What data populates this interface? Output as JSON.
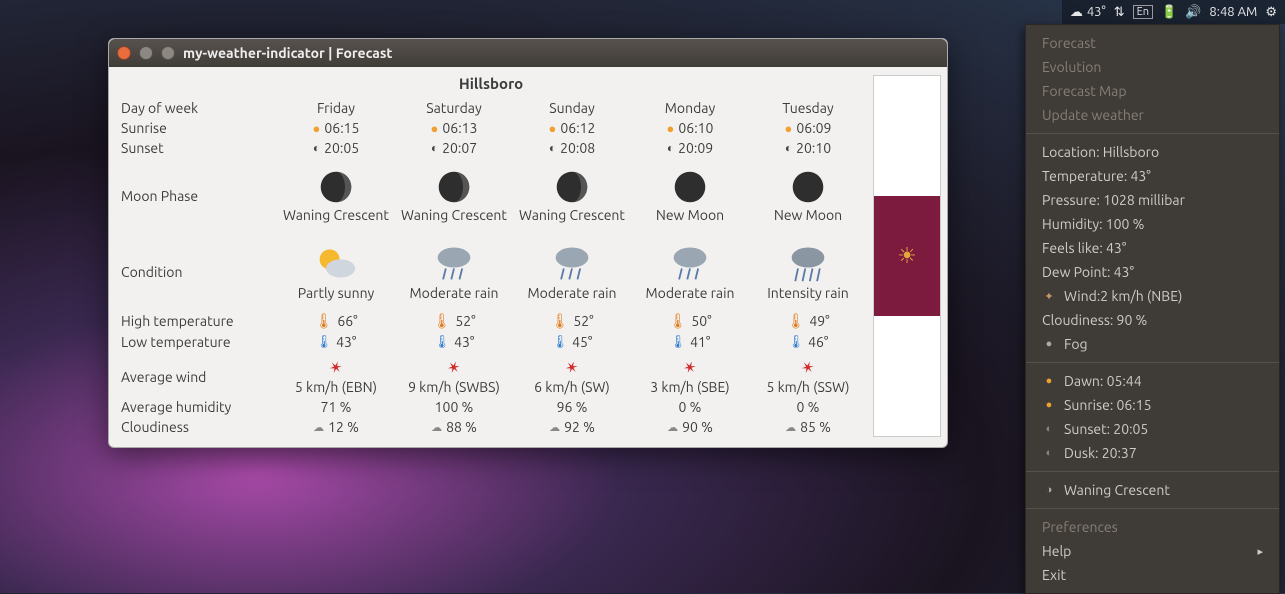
{
  "panel": {
    "weather_temp": "43°",
    "input_method": "En",
    "time": "8:48 AM"
  },
  "dropdown": {
    "top_items": [
      "Forecast",
      "Evolution",
      "Forecast Map",
      "Update weather"
    ],
    "location_label": "Location: Hillsboro",
    "temperature": "Temperature: 43°",
    "pressure": "Pressure: 1028 millibar",
    "humidity": "Humidity: 100 %",
    "feels_like": "Feels like: 43°",
    "dew_point": "Dew Point: 43°",
    "wind": "Wind:2 km/h (NBE)",
    "cloudiness": "Cloudiness: 90 %",
    "condition": "Fog",
    "dawn": "Dawn: 05:44",
    "sunrise": "Sunrise: 06:15",
    "sunset": "Sunset: 20:05",
    "dusk": "Dusk: 20:37",
    "moon_phase": "Waning Crescent",
    "preferences": "Preferences",
    "help": "Help",
    "exit": "Exit"
  },
  "window": {
    "title": "my-weather-indicator | Forecast",
    "city": "Hillsboro",
    "row_labels": {
      "day": "Day of week",
      "sunrise": "Sunrise",
      "sunset": "Sunset",
      "moon": "Moon Phase",
      "condition": "Condition",
      "high": "High temperature",
      "low": "Low temperature",
      "wind": "Average wind",
      "humidity": "Average humidity",
      "cloud": "Cloudiness"
    },
    "days": [
      {
        "name": "Friday",
        "sunrise": "06:15",
        "sunset": "20:05",
        "moon": "Waning Crescent",
        "condition": "Partly sunny",
        "high": "66°",
        "low": "43°",
        "wind": "5 km/h (EBN)",
        "humidity": "71 %",
        "cloud": "12 %"
      },
      {
        "name": "Saturday",
        "sunrise": "06:13",
        "sunset": "20:07",
        "moon": "Waning Crescent",
        "condition": "Moderate rain",
        "high": "52°",
        "low": "43°",
        "wind": "9 km/h (SWBS)",
        "humidity": "100 %",
        "cloud": "88 %"
      },
      {
        "name": "Sunday",
        "sunrise": "06:12",
        "sunset": "20:08",
        "moon": "Waning Crescent",
        "condition": "Moderate rain",
        "high": "52°",
        "low": "45°",
        "wind": "6 km/h (SW)",
        "humidity": "96 %",
        "cloud": "92 %"
      },
      {
        "name": "Monday",
        "sunrise": "06:10",
        "sunset": "20:09",
        "moon": "New Moon",
        "condition": "Moderate rain",
        "high": "50°",
        "low": "41°",
        "wind": "3 km/h (SBE)",
        "humidity": "0 %",
        "cloud": "90 %"
      },
      {
        "name": "Tuesday",
        "sunrise": "06:09",
        "sunset": "20:10",
        "moon": "New Moon",
        "condition": "Intensity rain",
        "high": "49°",
        "low": "46°",
        "wind": "5 km/h (SSW)",
        "humidity": "0 %",
        "cloud": "85 %"
      }
    ]
  }
}
